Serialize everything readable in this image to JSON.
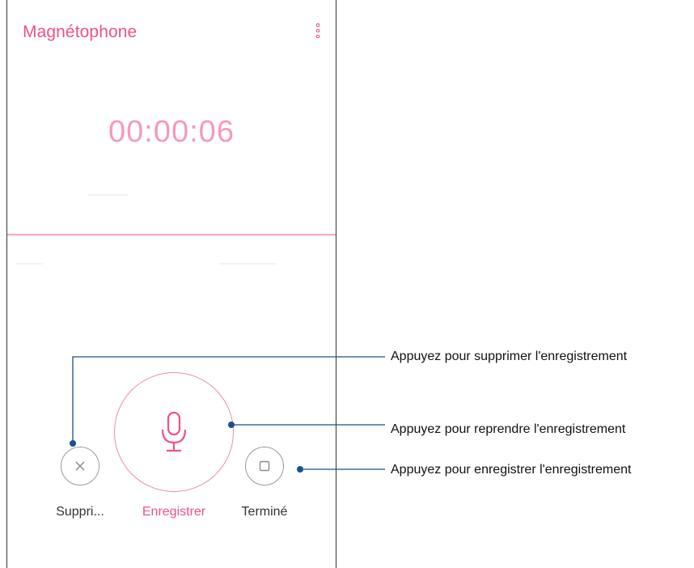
{
  "app": {
    "title": "Magnétophone",
    "menu_icon": "overflow-menu-icon"
  },
  "recorder": {
    "elapsed_time": "00:00:06",
    "buttons": {
      "delete": {
        "label": "Suppri...",
        "icon": "close-icon"
      },
      "record": {
        "label": "Enregistrer",
        "icon": "microphone-icon"
      },
      "done": {
        "label": "Terminé",
        "icon": "stop-icon"
      }
    }
  },
  "callouts": [
    {
      "text": "Appuyez pour supprimer l'enregistrement"
    },
    {
      "text": "Appuyez pour reprendre l'enregistrement"
    },
    {
      "text": "Appuyez pour enregistrer l'enregistrement"
    }
  ],
  "colors": {
    "accent": "#f0508c",
    "timer": "#f59ab8",
    "waveform": "#f4a6c0",
    "callout_line": "#1a4f8f",
    "neutral_button": "#9a9a9a"
  }
}
